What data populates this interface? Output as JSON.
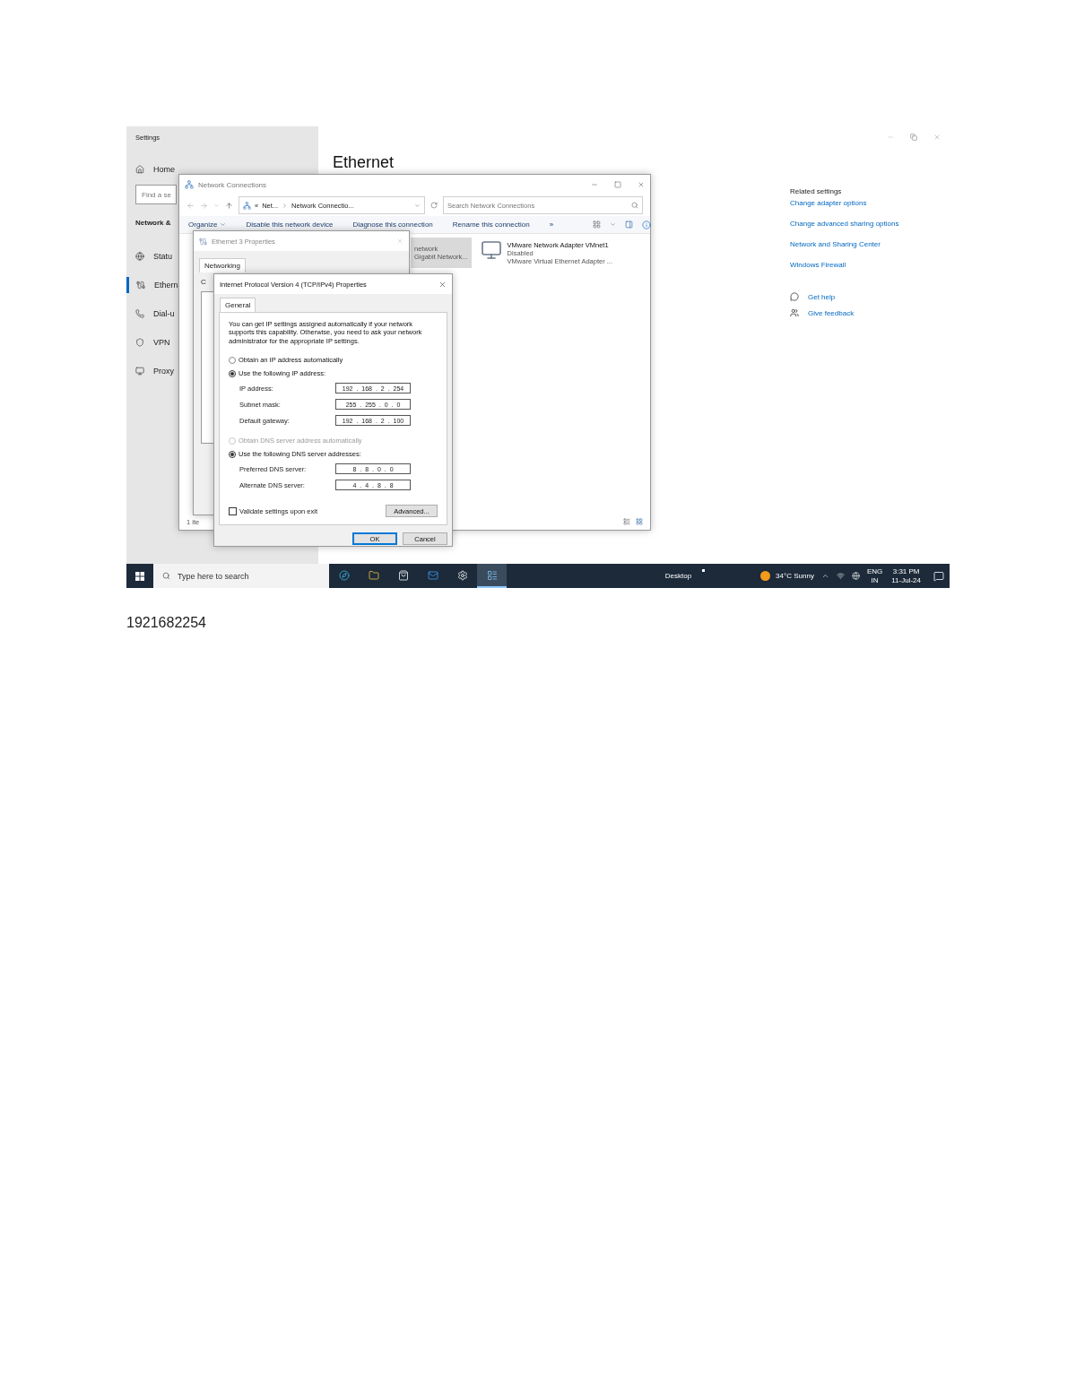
{
  "settings": {
    "title": "Settings",
    "home": "Home",
    "search_placeholder": "Find a se",
    "section": "Network &",
    "nav": [
      {
        "label": "Statu",
        "kind": "status",
        "selected": false
      },
      {
        "label": "Ethern",
        "kind": "ethernet",
        "selected": true
      },
      {
        "label": "Dial-u",
        "kind": "dialup",
        "selected": false
      },
      {
        "label": "VPN",
        "kind": "vpn",
        "selected": false
      },
      {
        "label": "Proxy",
        "kind": "proxy",
        "selected": false
      }
    ],
    "heading": "Ethernet",
    "related_title": "Related settings",
    "related_links": [
      "Change adapter options",
      "Change advanced sharing options",
      "Network and Sharing Center",
      "Windows Firewall"
    ],
    "help": [
      {
        "kind": "help",
        "label": "Get help"
      },
      {
        "kind": "feedback",
        "label": "Give feedback"
      }
    ]
  },
  "network_connections": {
    "title": "Network Connections",
    "overflow_mark": "«",
    "breadcrumb": [
      "Net...",
      "Network Connectio..."
    ],
    "search_placeholder": "Search Network Connections",
    "commands": [
      "Organize",
      "Disable this network device",
      "Diagnose this connection",
      "Rename this connection"
    ],
    "more": "»",
    "items": [
      {
        "kind": "ethernet",
        "selected": true,
        "lines": [
          "network",
          "Gigabit Network..."
        ]
      },
      {
        "kind": "vmware",
        "selected": false,
        "lines": [
          "VMware Network Adapter VMnet1",
          "Disabled",
          "VMware Virtual Ethernet Adapter ..."
        ]
      }
    ],
    "status": "1 ite"
  },
  "ethernet_properties": {
    "title": "Ethernet 3 Properties",
    "tab": "Networking",
    "fragment": "C"
  },
  "ipv4": {
    "title": "Internet Protocol Version 4 (TCP/IPv4) Properties",
    "tab": "General",
    "intro": "You can get IP settings assigned automatically if your network supports this capability. Otherwise, you need to ask your network administrator for the appropriate IP settings.",
    "ip_options": [
      {
        "label": "Obtain an IP address automatically",
        "selected": false,
        "disabled": false
      },
      {
        "label": "Use the following IP address:",
        "selected": true,
        "disabled": false
      }
    ],
    "ip_fields": [
      {
        "label": "IP address:",
        "value": "192 . 168 . 2 . 254"
      },
      {
        "label": "Subnet mask:",
        "value": "255 . 255 . 0 . 0"
      },
      {
        "label": "Default gateway:",
        "value": "192 . 168 . 2 . 100"
      }
    ],
    "dns_options": [
      {
        "label": "Obtain DNS server address automatically",
        "selected": false,
        "disabled": true
      },
      {
        "label": "Use the following DNS server addresses:",
        "selected": true,
        "disabled": false
      }
    ],
    "dns_fields": [
      {
        "label": "Preferred DNS server:",
        "value": "8 . 8 . 0 . 0"
      },
      {
        "label": "Alternate DNS server:",
        "value": "4 . 4 . 8 . 8"
      }
    ],
    "validate": {
      "label": "Validate settings upon exit",
      "checked": false
    },
    "advanced": "Advanced...",
    "buttons": [
      {
        "label": "OK",
        "default": true
      },
      {
        "label": "Cancel",
        "default": false
      }
    ]
  },
  "taskbar": {
    "search_placeholder": "Type here to search",
    "apps": [
      {
        "kind": "browser",
        "active": false
      },
      {
        "kind": "folder",
        "active": false
      },
      {
        "kind": "store",
        "active": false
      },
      {
        "kind": "mail",
        "active": false
      },
      {
        "kind": "settings",
        "active": false
      },
      {
        "kind": "control",
        "active": true
      }
    ],
    "desktop": "Desktop",
    "weather": "34°C  Sunny",
    "language": [
      "ENG",
      "IN"
    ],
    "time": "3:31 PM",
    "date": "11-Jul-24"
  },
  "document_text": "1921682254"
}
